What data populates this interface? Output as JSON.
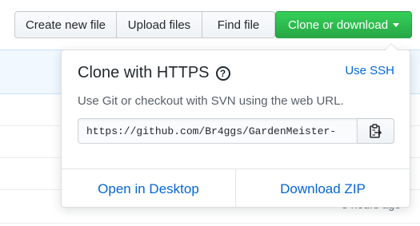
{
  "toolbar": {
    "create_label": "Create new file",
    "upload_label": "Upload files",
    "find_label": "Find file",
    "clone_label": "Clone or download"
  },
  "background": {
    "last_row_age": "3 hours ago"
  },
  "popover": {
    "title": "Clone with HTTPS",
    "help_icon": "?",
    "use_ssh_label": "Use SSH",
    "description": "Use Git or checkout with SVN using the web URL.",
    "clone_url": "https://github.com/Br4ggs/GardenMeister-",
    "copy_icon": "clipboard-icon",
    "open_desktop_label": "Open in Desktop",
    "download_zip_label": "Download ZIP"
  },
  "colors": {
    "accent_green": "#28a745",
    "link_blue": "#0366d6"
  }
}
